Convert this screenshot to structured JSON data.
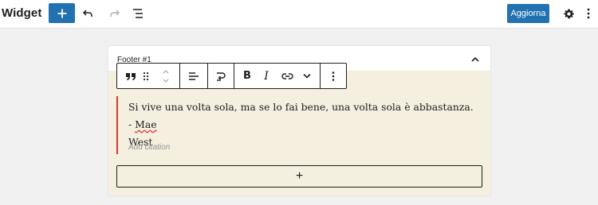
{
  "header": {
    "title": "Widget",
    "add_icon": "plus-icon",
    "undo_icon": "undo-icon",
    "redo_icon": "redo-icon",
    "list_view_icon": "list-view-icon",
    "update_label": "Aggiorna",
    "settings_icon": "gear-icon",
    "options_icon": "vertical-ellipsis-icon"
  },
  "widget_area": {
    "title": "Footer #1",
    "collapse_icon": "chevron-up-icon"
  },
  "block_toolbar": {
    "items": [
      "quote-icon",
      "drag-handle-icon",
      "move-up-down-icon",
      "align-icon",
      "transform-icon",
      "bold-icon",
      "italic-icon",
      "link-icon",
      "chevron-down-icon",
      "more-options-icon"
    ],
    "bold_label": "B",
    "italic_label": "I"
  },
  "quote": {
    "text_main": "Si vive una volta sola, ma se lo fai bene, una volta sola è abbastanza. - ",
    "text_name_part1": "Mae",
    "text_name_part2": "West",
    "citation_placeholder": "Add citation"
  },
  "appender": {
    "label": "+"
  },
  "colors": {
    "accent": "#2271b1",
    "quote_background": "#f5efdf",
    "quote_border": "#d63638"
  }
}
